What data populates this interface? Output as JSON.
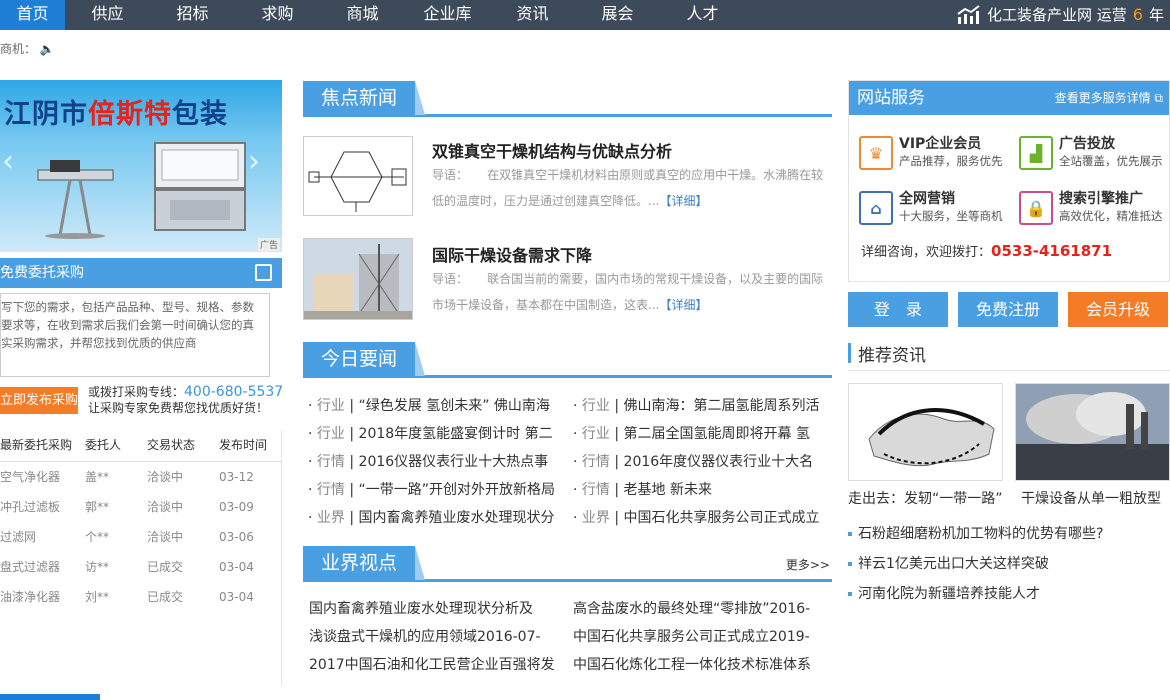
{
  "nav": {
    "items": [
      "首页",
      "供应",
      "招标",
      "求购",
      "商城",
      "企业库",
      "资讯",
      "展会",
      "人才"
    ],
    "brand": "化工装备产业网 运营",
    "years": "6",
    "years_unit": "年"
  },
  "ticker": {
    "label": "商机："
  },
  "banner": {
    "title_a": "江阴市",
    "title_b": "倍斯特",
    "title_c": "包装",
    "ad_tag": "广告"
  },
  "procure": {
    "title": "免费委托采购",
    "placeholder": "写下您的需求，包括产品品种、型号、规格、参数要求等，在收到需求后我们会第一时间确认您的真实采购需求，并帮您找到优质的供应商",
    "publish_button": "立即发布采购",
    "hotline_label": "或拨打采购专线：",
    "hotline_number": "400-680-5537",
    "hotline_note": "让采购专家免费帮您找优质好货！",
    "columns": [
      "最新委托采购",
      "委托人",
      "交易状态",
      "发布时间"
    ],
    "rows": [
      [
        "空气净化器",
        "盖**",
        "洽谈中",
        "03-12"
      ],
      [
        "冲孔过滤板",
        "郭**",
        "洽谈中",
        "03-09"
      ],
      [
        "过滤网",
        "个**",
        "洽谈中",
        "03-06"
      ],
      [
        "盘式过滤器",
        "访**",
        "已成交",
        "03-04"
      ],
      [
        "油漆净化器",
        "刘**",
        "已成交",
        "03-04"
      ]
    ]
  },
  "focus": {
    "title": "焦点新闻",
    "items": [
      {
        "headline": "双锥真空干燥机结构与优缺点分析",
        "summary_label": "导语：",
        "summary": "在双锥真空干燥机材料由原则或真空的应用中干燥。水沸腾在较低的温度时，压力是通过创建真空降低。...",
        "more": "【详细】"
      },
      {
        "headline": "国际干燥设备需求下降",
        "summary_label": "导语：",
        "summary": "联合国当前的需要，国内市场的常规干燥设备，以及主要的国际市场干燥设备，基本都在中国制造，这表...",
        "more": "【详细】"
      }
    ]
  },
  "today": {
    "title": "今日要闻",
    "left": [
      {
        "cat": "行业",
        "text": "“绿色发展 氢创未来” 佛山南海"
      },
      {
        "cat": "行业",
        "text": "2018年度氢能盛宴倒计时 第二"
      },
      {
        "cat": "行情",
        "text": "2016仪器仪表行业十大热点事"
      },
      {
        "cat": "行情",
        "text": "“一带一路”开创对外开放新格局"
      },
      {
        "cat": "业界",
        "text": "国内畜禽养殖业废水处理现状分"
      }
    ],
    "right": [
      {
        "cat": "行业",
        "text": "佛山南海：第二届氢能周系列活"
      },
      {
        "cat": "行业",
        "text": "第二届全国氢能周即将开幕 氢"
      },
      {
        "cat": "行情",
        "text": "2016年度仪器仪表行业十大名"
      },
      {
        "cat": "行情",
        "text": "老基地 新未来"
      },
      {
        "cat": "业界",
        "text": "中国石化共享服务公司正式成立"
      }
    ]
  },
  "views": {
    "title": "业界视点",
    "more": "更多>>",
    "left": [
      "国内畜禽养殖业废水处理现状分析及",
      "浅谈盘式干燥机的应用领域2016-07-",
      "2017中国石油和化工民营企业百强将发"
    ],
    "right": [
      "高含盐废水的最终处理“零排放”2016-",
      "中国石化共享服务公司正式成立2019-",
      "中国石化炼化工程一体化技术标准体系"
    ]
  },
  "services": {
    "title": "网站服务",
    "more": "查看更多服务详情",
    "items": [
      {
        "title": "VIP企业会员",
        "sub": "产品推荐，服务优先",
        "icon": "vip-icon",
        "color": "#f08a2c"
      },
      {
        "title": "广告投放",
        "sub": "全站覆盖，优先展示",
        "icon": "ad-chart-icon",
        "color": "#6ab42d"
      },
      {
        "title": "全网营销",
        "sub": "十大服务，坐等商机",
        "icon": "house-icon",
        "color": "#3f6fb5"
      },
      {
        "title": "搜索引擎推广",
        "sub": "高效优化，精准抵达",
        "icon": "lock-icon",
        "color": "#d04a8f"
      }
    ],
    "contact_label": "详细咨询，欢迎拨打：",
    "contact_phone": "0533-4161871"
  },
  "buttons": {
    "login": "登　录",
    "register": "免费注册",
    "upgrade": "会员升级"
  },
  "recommend": {
    "title": "推荐资讯",
    "cards": [
      "走出去：发轫“一带一路”",
      "干燥设备从单一粗放型"
    ],
    "list": [
      "石粉超细磨粉机加工物料的优势有哪些?",
      "祥云1亿美元出口大关这样突破",
      "河南化院为新疆培养技能人才"
    ]
  },
  "colors": {
    "nav_bg": "#3d4a5a",
    "accent": "#4a9fe3",
    "orange": "#f47c26",
    "phone_red": "#e3241a"
  }
}
